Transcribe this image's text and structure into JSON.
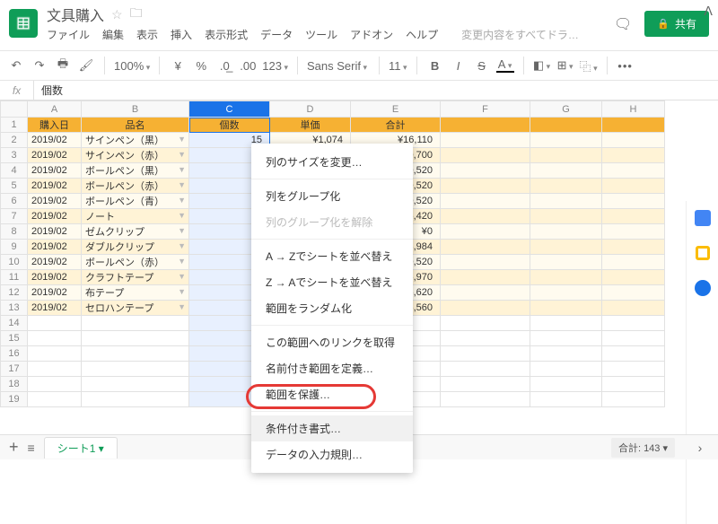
{
  "doc": {
    "title": "文具購入"
  },
  "menu": {
    "file": "ファイル",
    "edit": "編集",
    "view": "表示",
    "insert": "挿入",
    "format": "表示形式",
    "data": "データ",
    "tools": "ツール",
    "addons": "アドオン",
    "help": "ヘルプ",
    "changes": "変更内容をすべてドラ…"
  },
  "share": {
    "label": "共有"
  },
  "toolbar": {
    "zoom": "100%",
    "currency": "¥",
    "pct": "%",
    "dec_dec": ".0̲",
    "dec_inc": ".00",
    "num_fmt": "123",
    "font": "Sans Serif",
    "size": "11",
    "more": "•••"
  },
  "formula": {
    "fx": "fx",
    "value": "個数"
  },
  "cols": [
    "",
    "A",
    "B",
    "C",
    "D",
    "E",
    "F",
    "G",
    "H"
  ],
  "header": {
    "a": "購入日",
    "b": "品名",
    "c": "個数",
    "d": "単価",
    "e": "合計"
  },
  "rows": [
    {
      "n": 2,
      "date": "2019/02",
      "name": "サインペン（黒）",
      "c": "15",
      "d": "¥1,074",
      "e": "¥16,110"
    },
    {
      "n": 3,
      "date": "2019/02",
      "name": "サインペン（赤）",
      "c": "",
      "d": "",
      "e": "0,700"
    },
    {
      "n": 4,
      "date": "2019/02",
      "name": "ボールペン（黒）",
      "c": "",
      "d": "",
      "e": "0,520"
    },
    {
      "n": 5,
      "date": "2019/02",
      "name": "ボールペン（赤）",
      "c": "",
      "d": "",
      "e": "0,520"
    },
    {
      "n": 6,
      "date": "2019/02",
      "name": "ボールペン（青）",
      "c": "",
      "d": "",
      "e": "0,520"
    },
    {
      "n": 7,
      "date": "2019/02",
      "name": "ノート",
      "c": "",
      "d": "",
      "e": "5,420"
    },
    {
      "n": 8,
      "date": "2019/02",
      "name": "ゼムクリップ",
      "c": "",
      "d": "",
      "e": "¥0"
    },
    {
      "n": 9,
      "date": "2019/02",
      "name": "ダブルクリップ",
      "c": "",
      "d": "",
      "e": "3,984"
    },
    {
      "n": 10,
      "date": "2019/02",
      "name": "ボールペン（赤）",
      "c": "",
      "d": "",
      "e": "0,520"
    },
    {
      "n": 11,
      "date": "2019/02",
      "name": "クラフトテープ",
      "c": "",
      "d": "",
      "e": "5,970"
    },
    {
      "n": 12,
      "date": "2019/02",
      "name": "布テープ",
      "c": "",
      "d": "",
      "e": "6,620"
    },
    {
      "n": 13,
      "date": "2019/02",
      "name": "セロハンテープ",
      "c": "",
      "d": "",
      "e": "5,560"
    },
    {
      "n": 14
    },
    {
      "n": 15
    },
    {
      "n": 16
    },
    {
      "n": 17
    },
    {
      "n": 18
    },
    {
      "n": 19
    }
  ],
  "ctx": {
    "resize": "列のサイズを変更…",
    "group": "列をグループ化",
    "ungroup": "列のグループ化を解除",
    "sortAZ": "A → Zでシートを並べ替え",
    "sortZA": "Z → Aでシートを並べ替え",
    "randomize": "範囲をランダム化",
    "getlink": "この範囲へのリンクを取得",
    "named": "名前付き範囲を定義…",
    "protect": "範囲を保護…",
    "condfmt": "条件付き書式…",
    "validation": "データの入力規則…"
  },
  "bottom": {
    "sheet": "シート1",
    "sum": "合計: 143"
  }
}
